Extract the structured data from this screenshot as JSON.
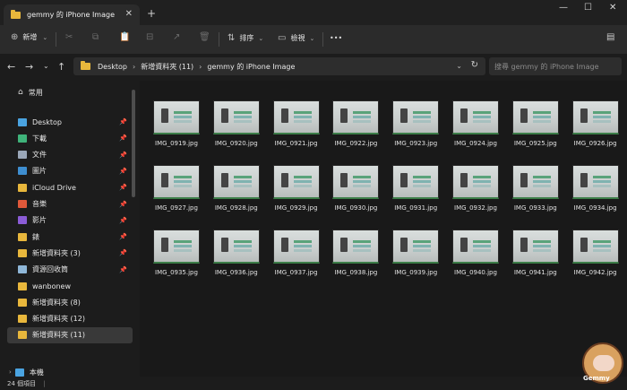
{
  "window": {
    "tab_title": "gemmy 的 iPhone Image",
    "tab_close": "✕",
    "new_tab": "+",
    "minimize": "—",
    "maximize": "☐",
    "close": "✕"
  },
  "toolbar": {
    "new_icon": "⊕",
    "new_label": "新增",
    "new_chevron": "⌄",
    "sort_icon": "⇅",
    "sort_label": "排序",
    "view_icon": "▭",
    "view_label": "檢視",
    "more": "•••",
    "details": "▤",
    "disabled_icons": [
      "✂",
      "⧉",
      "📋",
      "⊟",
      "↗",
      "🗑"
    ]
  },
  "nav": {
    "back": "←",
    "forward": "→",
    "recent": "⌄",
    "up": "↑",
    "breadcrumbs": [
      "Desktop",
      "新增資料夾 (11)",
      "gemmy 的 iPhone Image"
    ],
    "crumb_sep": "›",
    "address_chevron": "⌄",
    "refresh": "↻",
    "search_placeholder": "搜尋 gemmy 的 iPhone Image"
  },
  "sidebar": {
    "home": "常用",
    "items": [
      {
        "label": "Desktop",
        "pinned": true,
        "color": "#4aa3e0"
      },
      {
        "label": "下載",
        "pinned": true,
        "color": "#3fb37a"
      },
      {
        "label": "文件",
        "pinned": true,
        "color": "#9aa7b8"
      },
      {
        "label": "圖片",
        "pinned": true,
        "color": "#3e8ed0"
      },
      {
        "label": "iCloud Drive",
        "pinned": true,
        "color": "#e8b73c"
      },
      {
        "label": "音樂",
        "pinned": true,
        "color": "#e0583a"
      },
      {
        "label": "影片",
        "pinned": true,
        "color": "#8b5cd6"
      },
      {
        "label": "錶",
        "pinned": true,
        "color": "#e8b73c"
      },
      {
        "label": "新增資料夾 (3)",
        "pinned": true,
        "color": "#e8b73c"
      },
      {
        "label": "資源回收筒",
        "pinned": true,
        "color": "#8fb7d8"
      },
      {
        "label": "wanbonew",
        "pinned": false,
        "color": "#e8b73c"
      },
      {
        "label": "新增資料夾 (8)",
        "pinned": false,
        "color": "#e8b73c"
      },
      {
        "label": "新增資料夾 (12)",
        "pinned": false,
        "color": "#e8b73c"
      },
      {
        "label": "新增資料夾 (11)",
        "pinned": false,
        "color": "#e8b73c",
        "selected": true
      }
    ],
    "this_pc": "本機",
    "pin_glyph": "📌"
  },
  "files": [
    "IMG_0919.jpg",
    "IMG_0920.jpg",
    "IMG_0921.jpg",
    "IMG_0922.jpg",
    "IMG_0923.jpg",
    "IMG_0924.jpg",
    "IMG_0925.jpg",
    "IMG_0926.jpg",
    "IMG_0927.jpg",
    "IMG_0928.jpg",
    "IMG_0929.jpg",
    "IMG_0930.jpg",
    "IMG_0931.jpg",
    "IMG_0932.jpg",
    "IMG_0933.jpg",
    "IMG_0934.jpg",
    "IMG_0935.jpg",
    "IMG_0936.jpg",
    "IMG_0937.jpg",
    "IMG_0938.jpg",
    "IMG_0939.jpg",
    "IMG_0940.jpg",
    "IMG_0941.jpg",
    "IMG_0942.jpg"
  ],
  "status": {
    "count": "24 個項目",
    "divider": "|"
  },
  "watermark": {
    "text": "Gemmy"
  }
}
